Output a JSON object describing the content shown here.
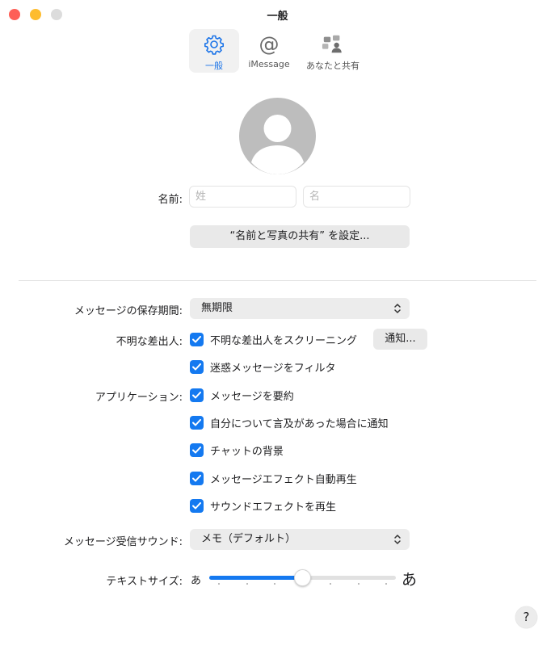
{
  "window": {
    "title": "一般"
  },
  "tabs": [
    {
      "label": "一般",
      "icon": "gear-icon",
      "selected": true
    },
    {
      "label": "iMessage",
      "icon": "at-sign-icon",
      "selected": false
    },
    {
      "label": "あなたと共有",
      "icon": "shared-with-you-icon",
      "selected": false
    }
  ],
  "profile": {
    "name_label": "名前:",
    "last_name_placeholder": "姓",
    "first_name_placeholder": "名",
    "share_button": "“名前と写真の共有” を設定..."
  },
  "settings": {
    "retention_label": "メッセージの保存期間:",
    "retention_value": "無期限",
    "unknown_senders_label": "不明な差出人:",
    "screen_unknown": {
      "label": "不明な差出人をスクリーニング",
      "checked": true
    },
    "notify_button": "通知...",
    "filter_junk": {
      "label": "迷惑メッセージをフィルタ",
      "checked": true
    },
    "applications_label": "アプリケーション:",
    "summarize": {
      "label": "メッセージを要約",
      "checked": true
    },
    "mention_notify": {
      "label": "自分について言及があった場合に通知",
      "checked": true
    },
    "chat_background": {
      "label": "チャットの背景",
      "checked": true
    },
    "auto_effects": {
      "label": "メッセージエフェクト自動再生",
      "checked": true
    },
    "sound_effects": {
      "label": "サウンドエフェクトを再生",
      "checked": true
    },
    "sound_label": "メッセージ受信サウンド:",
    "sound_value": "メモ（デフォルト）",
    "text_size_label": "テキストサイズ:",
    "text_size_small": "あ",
    "text_size_large": "あ",
    "text_size_level": 0.5,
    "text_size_steps": 7
  },
  "help": {
    "label": "?"
  },
  "colors": {
    "accent": "#1479f0",
    "close": "#fe5f57",
    "minimize": "#febc2e"
  }
}
